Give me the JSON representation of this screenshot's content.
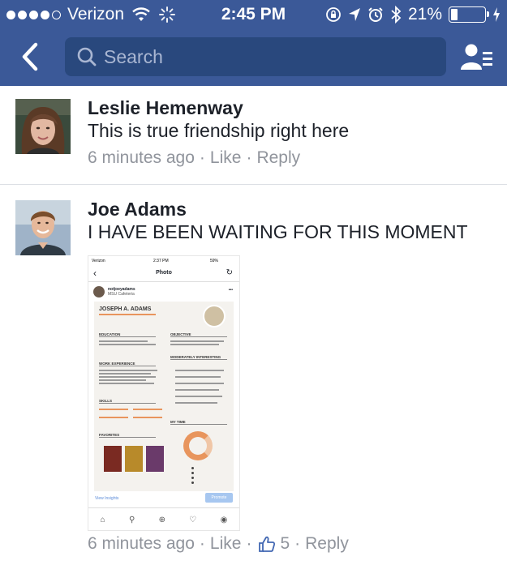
{
  "status_bar": {
    "carrier": "Verizon",
    "time": "2:45 PM",
    "battery_percent": "21%",
    "battery_level": 0.21
  },
  "navbar": {
    "search_placeholder": "Search",
    "back_icon": "chevron-left-icon",
    "friends_icon": "friend-list-icon"
  },
  "colors": {
    "header_bg": "#3b5998",
    "search_bg": "#29487d",
    "meta_text": "#90949c",
    "like_blue": "#4267b2"
  },
  "comments": [
    {
      "author": "Leslie Hemenway",
      "text": "This is true friendship right here",
      "time": "6 minutes ago",
      "like_label": "Like",
      "reply_label": "Reply",
      "separator": "·"
    },
    {
      "author": "Joe Adams",
      "text": "I HAVE BEEN WAITING FOR THIS MOMENT",
      "time": "6 minutes ago",
      "like_label": "Like",
      "reply_label": "Reply",
      "like_count": "5",
      "separator": "·",
      "attachment": {
        "status_carrier": "Verizon",
        "status_time": "2:37 PM",
        "status_battery": "59%",
        "nav_title": "Photo",
        "username": "notjoeyadams",
        "location": "MSU Cafeteria",
        "resume_name": "JOSEPH A. ADAMS",
        "sections": [
          "EDUCATION",
          "OBJECTIVE",
          "WORK EXPERIENCE",
          "MODERATELY INTERESTING",
          "SKILLS",
          "MY TIME",
          "FAVORITES"
        ],
        "view_insights": "View Insights",
        "promote": "Promote"
      }
    }
  ]
}
